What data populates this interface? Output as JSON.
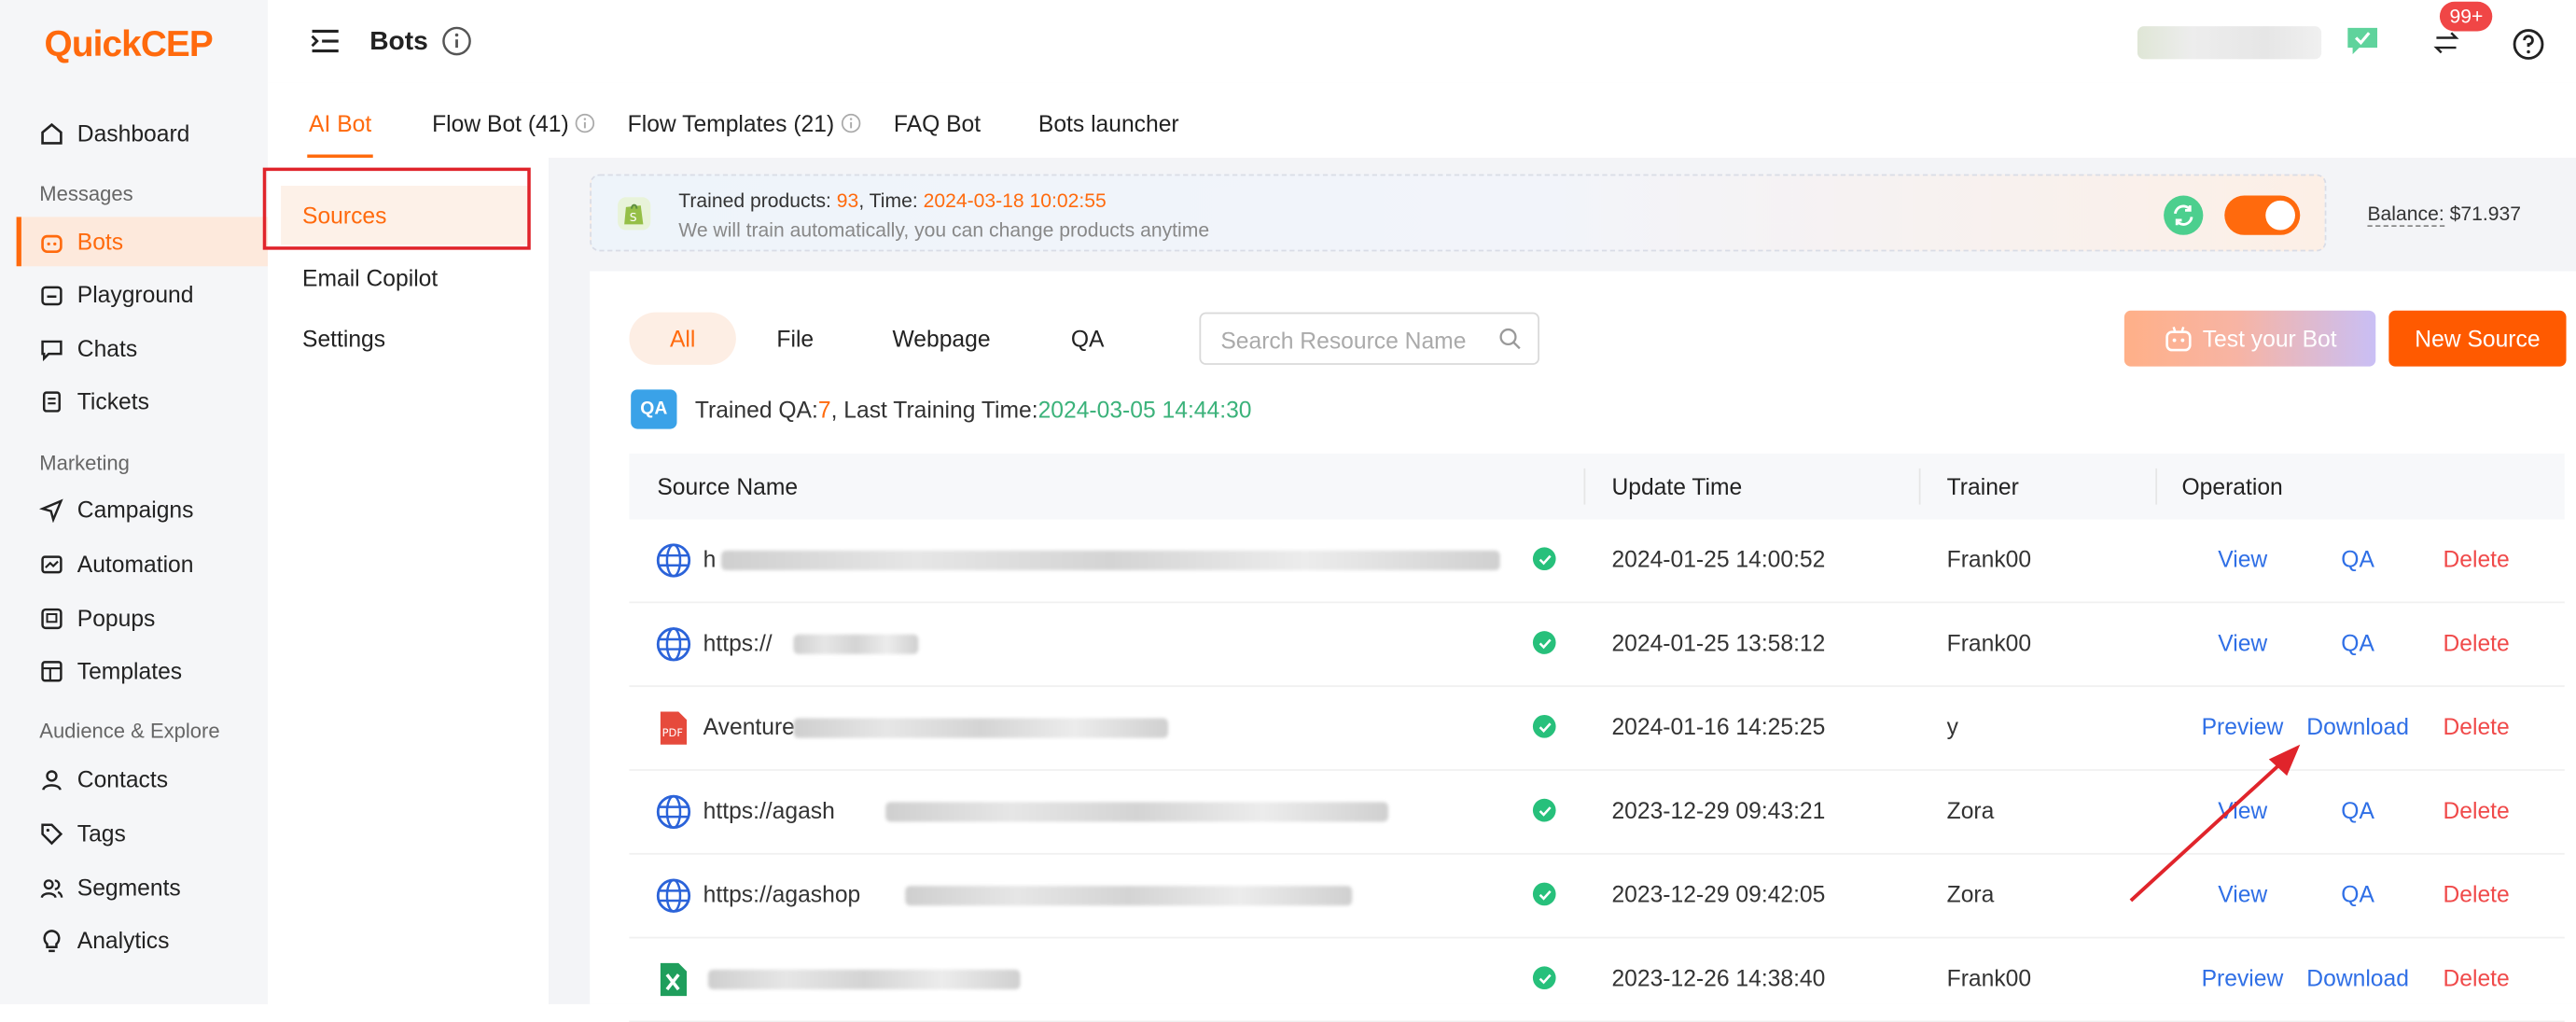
{
  "app": {
    "logo_q": "Q",
    "logo_rest": "uickCEP"
  },
  "sidebar": {
    "items": [
      {
        "label": "Dashboard",
        "icon": "home-icon"
      },
      {
        "section": "Messages"
      },
      {
        "label": "Bots",
        "icon": "bot-icon",
        "active": true
      },
      {
        "label": "Playground",
        "icon": "playground-icon"
      },
      {
        "label": "Chats",
        "icon": "chat-icon"
      },
      {
        "label": "Tickets",
        "icon": "ticket-icon"
      },
      {
        "section": "Marketing"
      },
      {
        "label": "Campaigns",
        "icon": "send-icon"
      },
      {
        "label": "Automation",
        "icon": "automation-icon"
      },
      {
        "label": "Popups",
        "icon": "popup-icon"
      },
      {
        "label": "Templates",
        "icon": "template-icon"
      },
      {
        "section": "Audience & Explore"
      },
      {
        "label": "Contacts",
        "icon": "user-icon"
      },
      {
        "label": "Tags",
        "icon": "tag-icon"
      },
      {
        "label": "Segments",
        "icon": "segments-icon"
      },
      {
        "label": "Analytics",
        "icon": "bulb-icon"
      }
    ]
  },
  "header": {
    "title": "Bots",
    "notifications": "99+"
  },
  "tabs": [
    {
      "label": "AI Bot",
      "active": true
    },
    {
      "label": "Flow Bot (41)"
    },
    {
      "label": "Flow Templates (21)"
    },
    {
      "label": "FAQ Bot"
    },
    {
      "label": "Bots launcher"
    }
  ],
  "subnav": [
    "Sources",
    "Email Copilot",
    "Settings"
  ],
  "banner": {
    "trained_label": "Trained products: ",
    "trained_count": "93",
    "time_label": ", Time: ",
    "time_value": "2024-03-18 10:02:55",
    "note": "We will train automatically, you can change products anytime",
    "toggle_on": true
  },
  "balance": {
    "label": "Balance:",
    "value": "$71.937"
  },
  "filters": [
    "All",
    "File",
    "Webpage",
    "QA"
  ],
  "search": {
    "placeholder": "Search Resource Name"
  },
  "buttons": {
    "test": "Test your Bot",
    "new": "New Source"
  },
  "qa_summary": {
    "badge": "QA",
    "label": "Trained QA: ",
    "count": "7",
    "sep": ", Last Training Time: ",
    "time": "2024-03-05 14:44:30"
  },
  "table": {
    "columns": [
      "Source Name",
      "Update Time",
      "Trainer",
      "Operation"
    ],
    "rows": [
      {
        "type": "webpage",
        "name": "h",
        "update": "2024-01-25 14:00:52",
        "trainer": "Frank00",
        "ops": [
          "View",
          "QA",
          "Delete"
        ]
      },
      {
        "type": "webpage",
        "name": "https://",
        "update": "2024-01-25 13:58:12",
        "trainer": "Frank00",
        "ops": [
          "View",
          "QA",
          "Delete"
        ]
      },
      {
        "type": "pdf",
        "name": "Aventure",
        "update": "2024-01-16 14:25:25",
        "trainer": "y",
        "ops": [
          "Preview",
          "Download",
          "Delete"
        ]
      },
      {
        "type": "webpage",
        "name": "https://agash",
        "update": "2023-12-29 09:43:21",
        "trainer": "Zora",
        "ops": [
          "View",
          "QA",
          "Delete"
        ]
      },
      {
        "type": "webpage",
        "name": "https://agashop",
        "update": "2023-12-29 09:42:05",
        "trainer": "Zora",
        "ops": [
          "View",
          "QA",
          "Delete"
        ]
      },
      {
        "type": "excel",
        "name": "",
        "update": "2023-12-26 14:38:40",
        "trainer": "Frank00",
        "ops": [
          "Preview",
          "Download",
          "Delete"
        ]
      }
    ]
  },
  "colors": {
    "accent": "#ff6a0d",
    "link": "#2f6fe6",
    "danger": "#f04a4a",
    "success": "#27c07b"
  }
}
